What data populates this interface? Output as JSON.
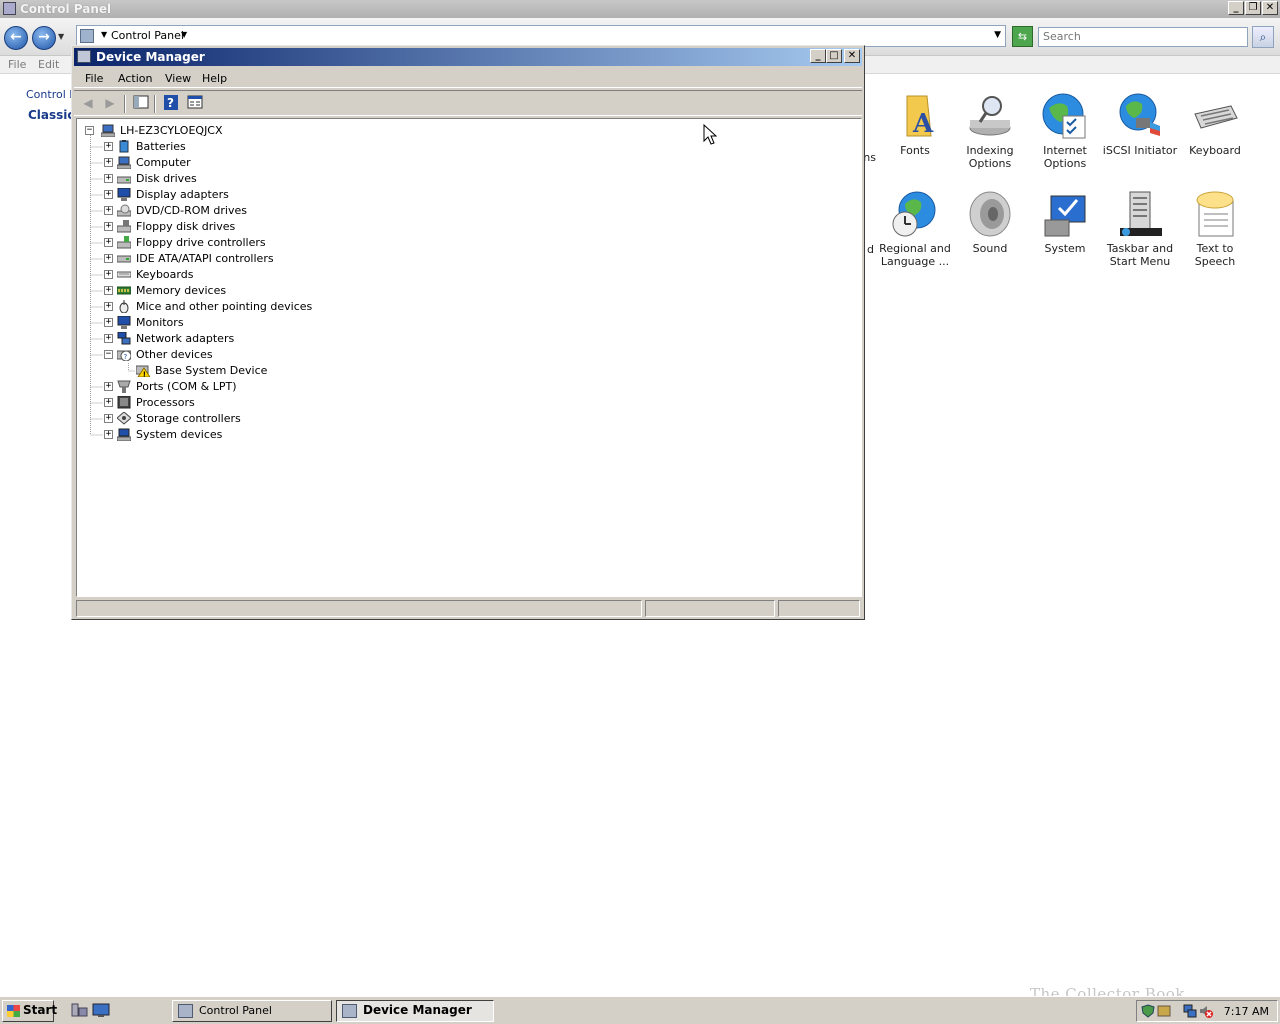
{
  "control_panel": {
    "title": "Control Panel",
    "address": "Control Panel",
    "search_placeholder": "Search",
    "menu": [
      "File",
      "Edit"
    ],
    "left_link": "Control P",
    "left_view": "Classic V",
    "icons_row1": [
      {
        "label": "ns",
        "icon": "partial-icon"
      },
      {
        "label": "Fonts",
        "icon": "fonts-folder-icon"
      },
      {
        "label": "Indexing Options",
        "icon": "indexing-icon"
      },
      {
        "label": "Internet Options",
        "icon": "internet-options-icon"
      },
      {
        "label": "iSCSI Initiator",
        "icon": "iscsi-icon"
      },
      {
        "label": "Keyboard",
        "icon": "keyboard-icon"
      }
    ],
    "icons_row2": [
      {
        "label": "d",
        "icon": "partial-icon"
      },
      {
        "label": "Regional and Language ...",
        "icon": "regional-icon"
      },
      {
        "label": "Sound",
        "icon": "sound-icon"
      },
      {
        "label": "System",
        "icon": "system-icon"
      },
      {
        "label": "Taskbar and Start Menu",
        "icon": "taskbar-icon"
      },
      {
        "label": "Text to Speech",
        "icon": "speech-icon"
      }
    ]
  },
  "device_manager": {
    "title": "Device Manager",
    "menu": {
      "file": "File",
      "action": "Action",
      "view": "View",
      "help": "Help"
    },
    "root": "LH-EZ3CYLOEQJCX",
    "categories": [
      "Batteries",
      "Computer",
      "Disk drives",
      "Display adapters",
      "DVD/CD-ROM drives",
      "Floppy disk drives",
      "Floppy drive controllers",
      "IDE ATA/ATAPI controllers",
      "Keyboards",
      "Memory devices",
      "Mice and other pointing devices",
      "Monitors",
      "Network adapters",
      "Other devices",
      "Base System Device",
      "Ports (COM & LPT)",
      "Processors",
      "Storage controllers",
      "System devices"
    ]
  },
  "taskbar": {
    "start": "Start",
    "tasks": [
      "Control Panel",
      "Device Manager"
    ],
    "clock": "7:17 AM",
    "watermark": "The Collector Book"
  },
  "colors": {
    "title_active_start": "#0a246a",
    "title_active_end": "#a6caf0",
    "window_face": "#d4d0c8"
  }
}
